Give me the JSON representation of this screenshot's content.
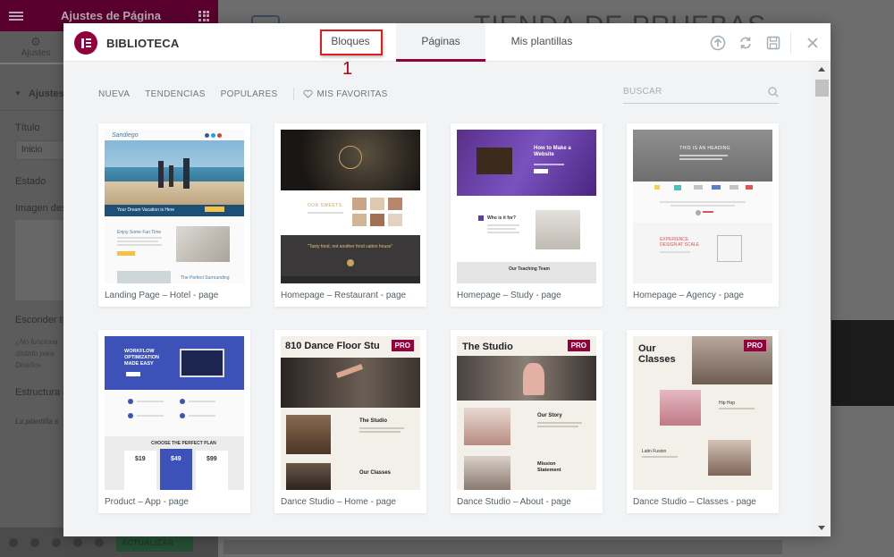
{
  "editor": {
    "panel_title": "Ajustes de Página",
    "tab_label": "Ajustes",
    "section_title": "Ajustes",
    "fields": {
      "title_label": "Título",
      "title_value": "Inicio",
      "status_label": "Estado",
      "image_label": "Imagen des",
      "hide_label": "Esconder tí",
      "hide_help_1": "¿No funciona",
      "hide_help_2": "distinto para",
      "hide_help_3": "Diseño»",
      "structure_label": "Estructura d",
      "structure_help": "La plantilla s"
    },
    "footer": {
      "update_label": "ACTUALIZAR"
    },
    "preview": {
      "site_title": "TIENDA DE PRUEBAS"
    }
  },
  "modal": {
    "title": "BIBLIOTECA",
    "tabs": [
      {
        "label": "Bloques"
      },
      {
        "label": "Páginas",
        "active": true
      },
      {
        "label": "Mis plantillas"
      }
    ],
    "annotation": "1",
    "filters": [
      "NUEVA",
      "TENDENCIAS",
      "POPULARES"
    ],
    "favorites_label": "MIS FAVORITAS",
    "search_placeholder": "BUSCAR",
    "header_icons": [
      "upload-icon",
      "sync-icon",
      "save-icon",
      "close-icon"
    ],
    "pro_badge": "PRO",
    "templates": [
      {
        "label": "Landing Page – Hotel - page",
        "pro": false,
        "thumb": {
          "caption": "Your Dream Vacation is Here",
          "sub": "Enjoy Some Fun Time",
          "sub2": "The Perfect Surrounding"
        }
      },
      {
        "label": "Homepage – Restaurant - page",
        "pro": false,
        "thumb": {
          "caption": "OUR SWEETS",
          "quote": "\"Tasty food, not another food cation house\""
        }
      },
      {
        "label": "Homepage – Study - page",
        "pro": false,
        "thumb": {
          "heading": "How to Make a Website",
          "sub": "Who is it for?",
          "foot": "Our Teaching Team"
        }
      },
      {
        "label": "Homepage – Agency - page",
        "pro": false,
        "thumb": {
          "heading": "THIS IS AN HEADING",
          "sub": "EXPERIENCE DESIGN AT SCALE"
        }
      },
      {
        "label": "Product – App - page",
        "pro": false,
        "thumb": {
          "heading": "WORKFLOW OPTIMIZATION MADE EASY",
          "plan": "CHOOSE THE PERFECT PLAN",
          "prices": [
            "$19",
            "$49",
            "$99"
          ]
        }
      },
      {
        "label": "Dance Studio – Home - page",
        "pro": true,
        "thumb": {
          "heading": "810 Dance Floor Stu",
          "sub": "The Studio",
          "sub2": "Our Classes"
        }
      },
      {
        "label": "Dance Studio – About - page",
        "pro": true,
        "thumb": {
          "heading": "The Studio",
          "sub": "Our Story",
          "sub2": "Mission Statement"
        }
      },
      {
        "label": "Dance Studio – Classes - page",
        "pro": true,
        "thumb": {
          "heading": "Our Classes",
          "sub": "Hip Hop",
          "sub2": "Latin Fusion"
        }
      }
    ]
  }
}
